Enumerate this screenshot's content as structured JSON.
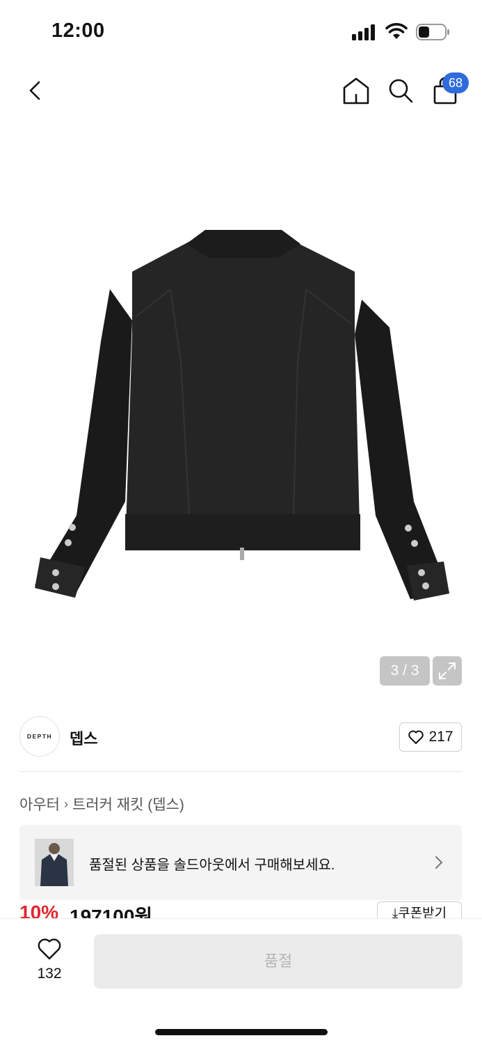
{
  "status_bar": {
    "time": "12:00"
  },
  "nav": {
    "cart_count": "68"
  },
  "gallery": {
    "indicator": "3 / 3"
  },
  "brand": {
    "logo_text": "DEPTH",
    "name": "뎁스",
    "like_count": "217"
  },
  "breadcrumb": {
    "category": "아우터",
    "product": "트러커 재킷 (뎁스)"
  },
  "banner": {
    "text": "품절된 상품을 솔드아웃에서 구매해보세요."
  },
  "price": {
    "discount": "10%",
    "amount": "197100원",
    "coupon_label": "⤓쿠폰받기"
  },
  "bottom": {
    "wish_count": "132",
    "soldout_label": "품절"
  },
  "colors": {
    "accent_blue": "#2f6bdb",
    "discount_red": "#e3262e"
  }
}
